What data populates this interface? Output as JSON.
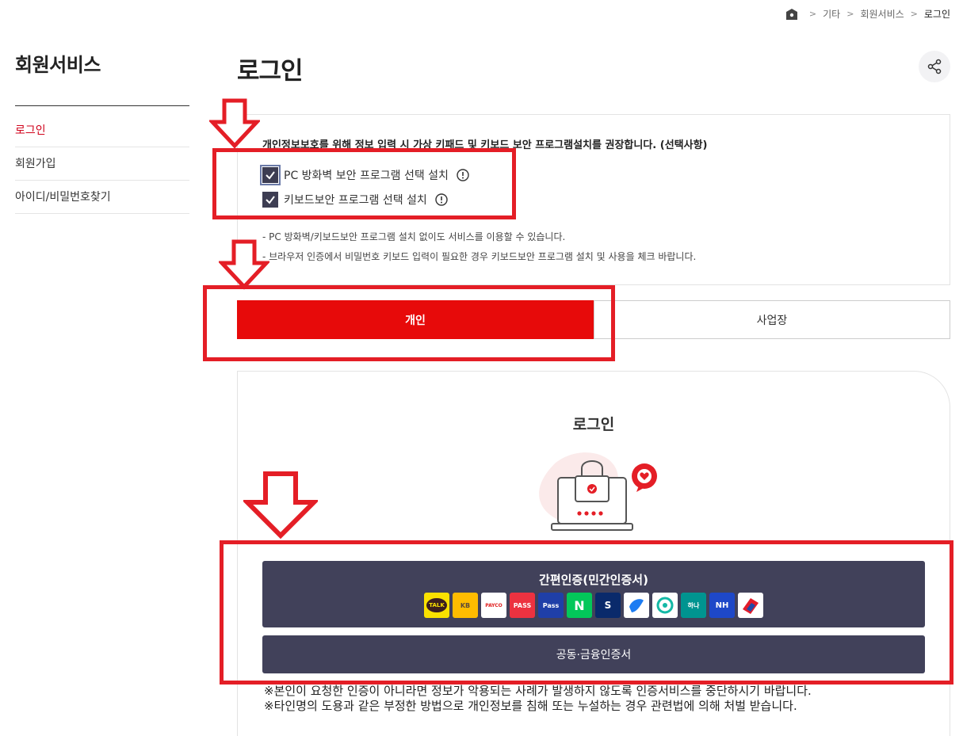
{
  "breadcrumb": {
    "items": [
      "기타",
      "회원서비스",
      "로그인"
    ]
  },
  "sidebar": {
    "title": "회원서비스",
    "items": [
      {
        "label": "로그인",
        "active": true
      },
      {
        "label": "회원가입",
        "active": false
      },
      {
        "label": "아이디/비밀번호찾기",
        "active": false
      }
    ]
  },
  "page": {
    "title": "로그인"
  },
  "security": {
    "notice": "개인정보보호를 위해 정보 입력 시 가상 키패드 및 키보드 보안 프로그램설치를 권장합니다. (선택사항)",
    "options": [
      {
        "label": "PC 방화벽 보안 프로그램 선택 설치",
        "checked": true
      },
      {
        "label": "키보드보안 프로그램 선택 설치",
        "checked": true
      }
    ],
    "descriptions": [
      "- PC 방화벽/키보드보안 프로그램 설치 없이도 서비스를 이용할 수 있습니다.",
      "- 브라우저 인증에서 비밀번호 키보드 입력이 필요한 경우 키보드보안 프로그램 설치 및 사용을 체크 바랍니다."
    ]
  },
  "tabs": {
    "personal": "개인",
    "business": "사업장"
  },
  "login_card": {
    "title": "로그인",
    "simple_auth_label": "간편인증(민간인증서)",
    "provider_logos": [
      {
        "name": "kakao",
        "text": "TALK"
      },
      {
        "name": "kb",
        "text": "KB"
      },
      {
        "name": "payco",
        "text": "PAYCO"
      },
      {
        "name": "pass",
        "text": "PASS"
      },
      {
        "name": "samsung-pass",
        "text": "Pass"
      },
      {
        "name": "naver",
        "text": "N"
      },
      {
        "name": "shinhan",
        "text": "S"
      },
      {
        "name": "toss",
        "text": ""
      },
      {
        "name": "banksalad",
        "text": ""
      },
      {
        "name": "hana",
        "text": "하나"
      },
      {
        "name": "nh",
        "text": "NH"
      },
      {
        "name": "woori",
        "text": ""
      }
    ],
    "joint_cert_label": "공동·금융인증서",
    "warnings": [
      "※본인이 요청한 인증이 아니라면 정보가 악용되는 사례가 발생하지 않도록 인증서비스를 중단하시기 바랍니다.",
      "※타인명의 도용과 같은 부정한 방법으로 개인정보를 침해 또는 누설하는 경우 관련법에 의해 처벌 받습니다."
    ]
  },
  "colors": {
    "accent": "#e70a0a",
    "dark_button": "#41415a",
    "annotation": "#e41e26"
  }
}
